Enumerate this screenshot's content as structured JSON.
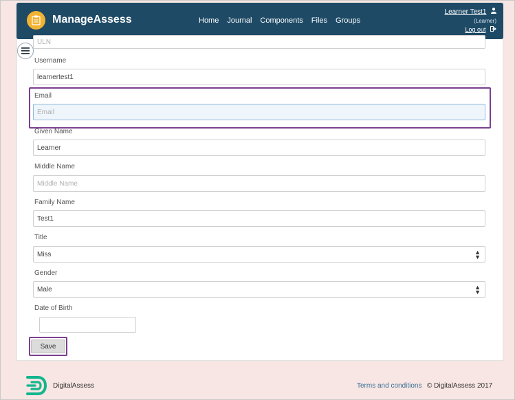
{
  "header": {
    "brand": "ManageAssess",
    "nav": [
      "Home",
      "Journal",
      "Components",
      "Files",
      "Groups"
    ],
    "user_name": "Learner Test1",
    "user_role": "(Learner)",
    "logout": "Log out"
  },
  "form": {
    "uln": {
      "label": "ULN"
    },
    "username": {
      "label": "Username",
      "value": "learnertest1"
    },
    "email": {
      "label": "Email",
      "placeholder": "Email"
    },
    "given_name": {
      "label": "Given Name",
      "value": "Learner"
    },
    "middle_name": {
      "label": "Middle Name",
      "placeholder": "Middle Name"
    },
    "family_name": {
      "label": "Family Name",
      "value": "Test1"
    },
    "title": {
      "label": "Title",
      "value": "Miss"
    },
    "gender": {
      "label": "Gender",
      "value": "Male"
    },
    "dob": {
      "label": "Date of Birth",
      "value": ""
    },
    "save_label": "Save"
  },
  "footer": {
    "brand": "DigitalAssess",
    "terms": "Terms and conditions",
    "copyright": "© DigitalAssess 2017"
  },
  "colors": {
    "navbar": "#1e4a66",
    "accent_logo": "#f2b332",
    "highlight": "#7b3f8f",
    "page_bg": "#f7e6e3",
    "footer_logo": "#13b58e"
  },
  "icons": {
    "brand": "clipboard-icon",
    "menu": "hamburger-menu-icon",
    "user": "user-icon",
    "logout": "logout-icon",
    "select": "select-arrows-icon",
    "footer": "digitalassess-logo-icon"
  }
}
